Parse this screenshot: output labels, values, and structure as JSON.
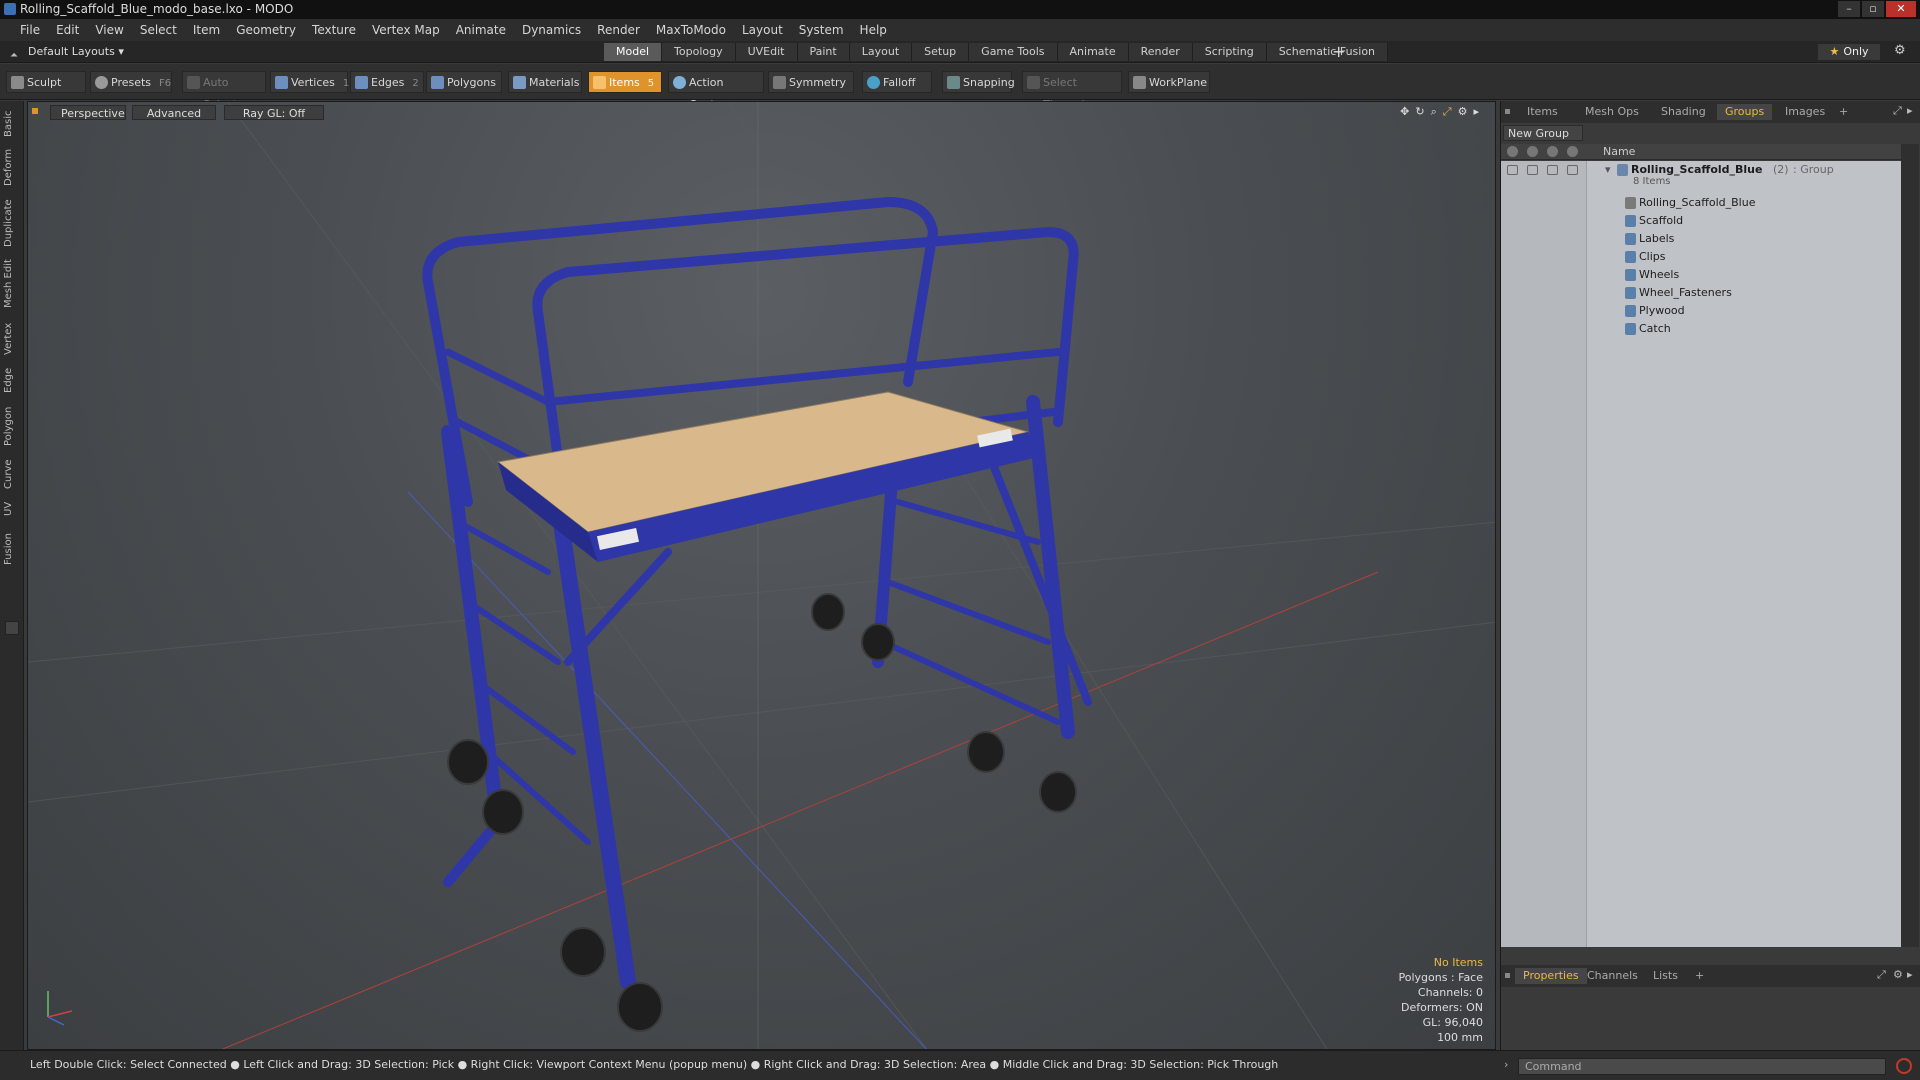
{
  "window": {
    "title": "Rolling_Scaffold_Blue_modo_base.lxo - MODO",
    "controls": [
      "–",
      "▫",
      "✕"
    ]
  },
  "menu": [
    "File",
    "Edit",
    "View",
    "Select",
    "Item",
    "Geometry",
    "Texture",
    "Vertex Map",
    "Animate",
    "Dynamics",
    "Render",
    "MaxToModo",
    "Layout",
    "System",
    "Help"
  ],
  "layout": {
    "current": "Default Layouts",
    "tabs": [
      "Model",
      "Topology",
      "UVEdit",
      "Paint",
      "Layout",
      "Setup",
      "Game Tools",
      "Animate",
      "Render",
      "Scripting",
      "Schematic Fusion"
    ],
    "active_tab": "Model",
    "add_label": "+",
    "only_label": "Only"
  },
  "toolbar": {
    "sculpt": "Sculpt",
    "presets": "Presets",
    "presets_key": "F6",
    "auto_select": "Auto Select",
    "vertices": "Vertices",
    "vertices_count": "1",
    "edges": "Edges",
    "edges_count": "2",
    "polygons": "Polygons",
    "materials": "Materials",
    "items": "Items",
    "items_count": "5",
    "action_center": "Action Center",
    "symmetry": "Symmetry",
    "falloff": "Falloff",
    "snapping": "Snapping",
    "select_through": "Select Through",
    "workplane": "WorkPlane"
  },
  "left_tabs": [
    "Basic",
    "Deform",
    "Duplicate",
    "Mesh Edit",
    "Vertex",
    "Edge",
    "Polygon",
    "Curve",
    "UV",
    "Fusion"
  ],
  "viewport": {
    "view": "Perspective",
    "shading": "Advanced",
    "raygl": "Ray GL: Off",
    "info": {
      "selection": "No Items",
      "polygons": "Polygons : Face",
      "channels": "Channels: 0",
      "deformers": "Deformers: ON",
      "gl": "GL: 96,040",
      "scale": "100 mm"
    }
  },
  "right_panel": {
    "tabs": [
      "Items",
      "Mesh Ops",
      "Shading",
      "Groups",
      "Images"
    ],
    "active_tab": "Groups",
    "add_tab": "+",
    "new_group": "New Group",
    "column_name": "Name",
    "group": {
      "name": "Rolling_Scaffold_Blue",
      "count": "(2)",
      "type": ": Group",
      "items_label": "8 Items"
    },
    "children": [
      "Rolling_Scaffold_Blue",
      "Scaffold",
      "Labels",
      "Clips",
      "Wheels",
      "Wheel_Fasteners",
      "Plywood",
      "Catch"
    ],
    "props_tabs": [
      "Properties",
      "Channels",
      "Lists"
    ],
    "props_active": "Properties",
    "props_add": "+"
  },
  "status_bar": "Left Double Click: Select Connected ● Left Click and Drag: 3D Selection: Pick ● Right Click: Viewport Context Menu (popup menu) ● Right Click and Drag: 3D Selection: Area ● Middle Click and Drag: 3D Selection: Pick Through",
  "command": {
    "placeholder": "Command"
  },
  "colors": {
    "accent": "#e8b94a",
    "active_tool": "#e0932a",
    "scaffold": "#2f36a8",
    "plywood": "#d9b98c"
  }
}
